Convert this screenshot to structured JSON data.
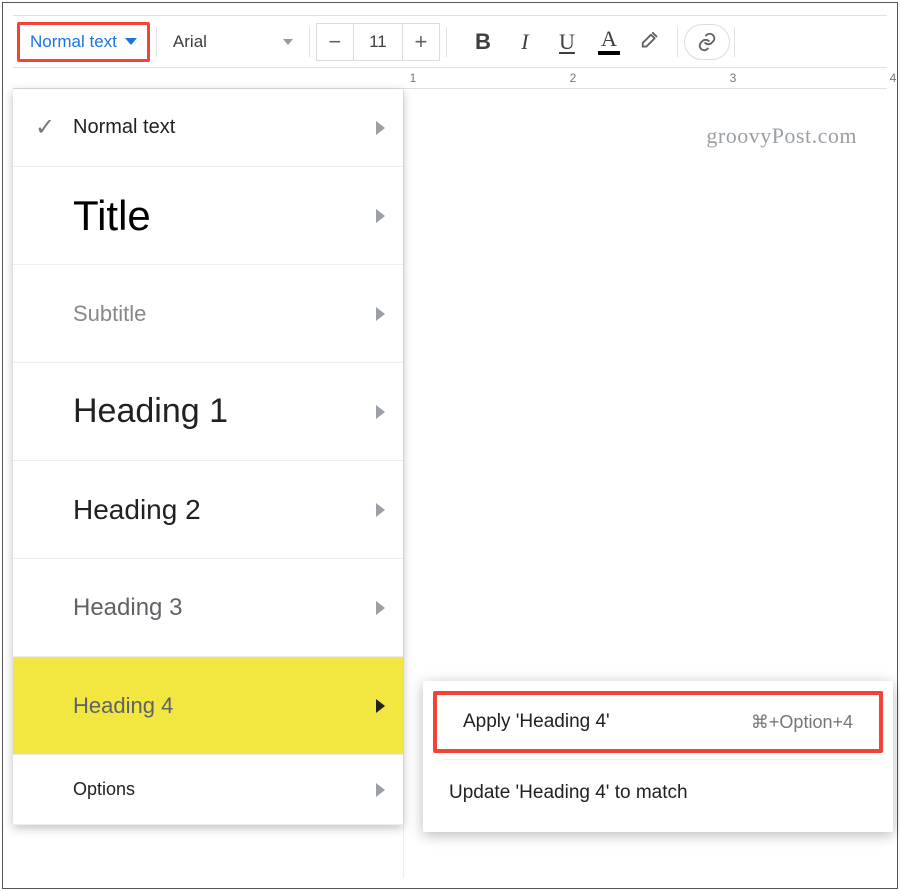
{
  "toolbar": {
    "para_style_label": "Normal text",
    "font_label": "Arial",
    "font_size": "11"
  },
  "ruler": {
    "marks": [
      "1",
      "2",
      "3",
      "4"
    ]
  },
  "watermark": "groovyPost.com",
  "styles_menu": {
    "normal": "Normal text",
    "title": "Title",
    "subtitle": "Subtitle",
    "h1": "Heading 1",
    "h2": "Heading 2",
    "h3": "Heading 3",
    "h4": "Heading 4",
    "options": "Options"
  },
  "submenu": {
    "apply_label": "Apply 'Heading 4'",
    "apply_shortcut": "⌘+Option+4",
    "update_label": "Update 'Heading 4' to match"
  }
}
